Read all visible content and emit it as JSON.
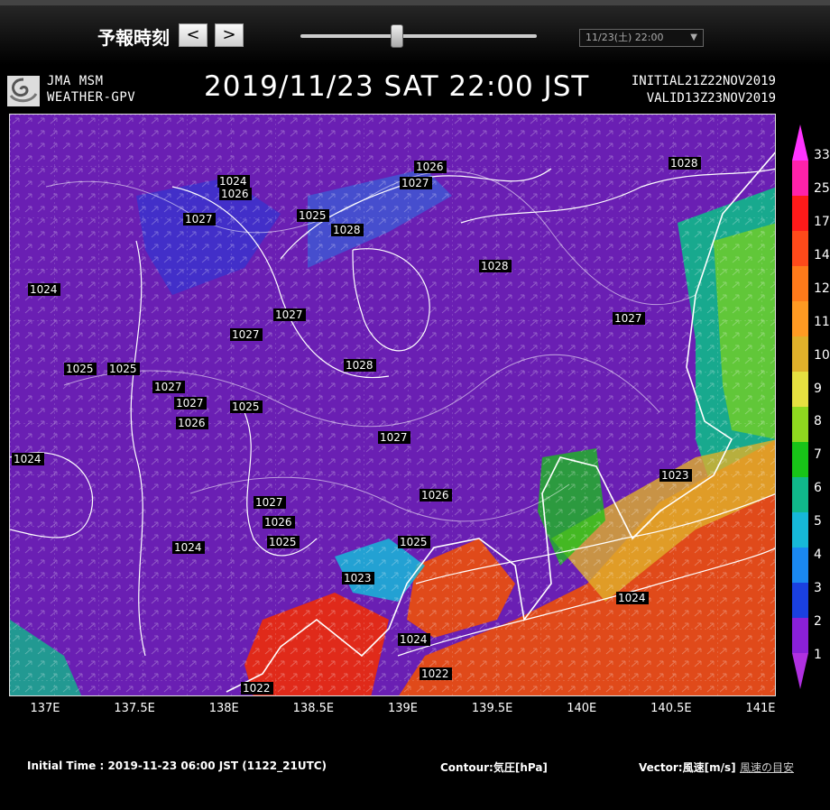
{
  "toolbar": {
    "forecast_time_label": "予報時刻",
    "prev_label": "<",
    "next_label": ">",
    "selected_time": "11/23(土) 22:00",
    "slider_fraction": 0.41
  },
  "header": {
    "model_line1": "JMA MSM",
    "model_line2": "WEATHER-GPV",
    "title": "2019/11/23 SAT 22:00 JST",
    "initial": "INITIAL21Z22NOV2019",
    "valid": "VALID13Z23NOV2019"
  },
  "map": {
    "longitude_labels": [
      "137E",
      "137.5E",
      "138E",
      "138.5E",
      "139E",
      "139.5E",
      "140E",
      "140.5E",
      "141E"
    ],
    "isobar_labels": [
      "1024",
      "1026",
      "1027",
      "1025",
      "1028",
      "1026",
      "1027",
      "1028",
      "1028",
      "1024",
      "1027",
      "1027",
      "1028",
      "1027",
      "1025",
      "1025",
      "1027",
      "1027",
      "1026",
      "1025",
      "1024",
      "1027",
      "1026",
      "1025",
      "1027",
      "1026",
      "1024",
      "1024",
      "1025",
      "1023",
      "1024",
      "1023",
      "1022",
      "1022"
    ],
    "background_color": "#6a1fb3"
  },
  "colorbar": {
    "labels": [
      "33",
      "25",
      "17",
      "14",
      "12",
      "11",
      "10",
      "9",
      "8",
      "7",
      "6",
      "5",
      "4",
      "3",
      "2",
      "1"
    ],
    "colors": [
      "#ff33ff",
      "#ff22aa",
      "#ff1a1a",
      "#ff4a1a",
      "#ff7a1a",
      "#ff9a22",
      "#e0b02a",
      "#e6e040",
      "#8fd81f",
      "#18c418",
      "#10b88a",
      "#16b8d8",
      "#1a88f0",
      "#1a40e0",
      "#8a20d8",
      "#b030e0"
    ]
  },
  "footer": {
    "initial_time": "Initial Time : 2019-11-23 06:00 JST (1122_21UTC)",
    "contour": "Contour:気圧[hPa]",
    "vector": "Vector:風速[m/s]",
    "guide_link": "風速の目安"
  }
}
